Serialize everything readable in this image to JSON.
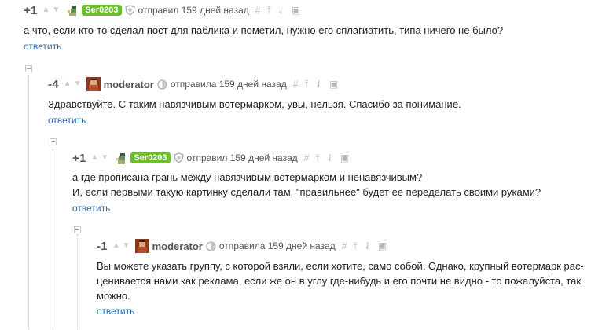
{
  "comments": [
    {
      "score": "+1",
      "username": "Ser0203",
      "meta": "отправил 159 дней назад",
      "lines": [
        "а что, если кто-то сделал пост для паблика и пометил, нужно его сплагиатить, типа ничего не было?"
      ],
      "reply": "ответить"
    },
    {
      "score": "-4",
      "username": "moderator",
      "meta": "отправила 159 дней назад",
      "lines": [
        "Здравствуйте. С таким навязчивым вотермарком, увы, нельзя. Спасибо за понимание."
      ],
      "reply": "ответить"
    },
    {
      "score": "+1",
      "username": "Ser0203",
      "meta": "отправил 159 дней назад",
      "lines": [
        "а где прописана грань между навязчивым вотермарком и ненавязчивым?",
        "И, если первыми такую картинку сделали там, \"правильнее\" будет ее переделать своими руками?"
      ],
      "reply": "ответить"
    },
    {
      "score": "-1",
      "username": "moderator",
      "meta": "отправила 159 дней назад",
      "lines": [
        "Вы можете указать группу, с которой взяли, если хотите, само собой. Однако, крупный вотермарк рас-",
        "ценивается нами как реклама, если же он в углу где-нибудь и его почти не видно - то пожалуйста, так",
        "можно."
      ],
      "reply": "ответить"
    }
  ],
  "icons": {
    "vote_up": "vote-up-icon",
    "vote_down": "vote-down-icon",
    "link": "hash-link-icon",
    "parent": "arrow-up-icon",
    "branch": "branch-icon",
    "save": "save-icon",
    "collapse": "collapse-icon"
  },
  "colors": {
    "badge": "#6bbf2c",
    "reply_link": "#2a6cae",
    "score": "#555555",
    "icons": "#b3b6ba"
  }
}
